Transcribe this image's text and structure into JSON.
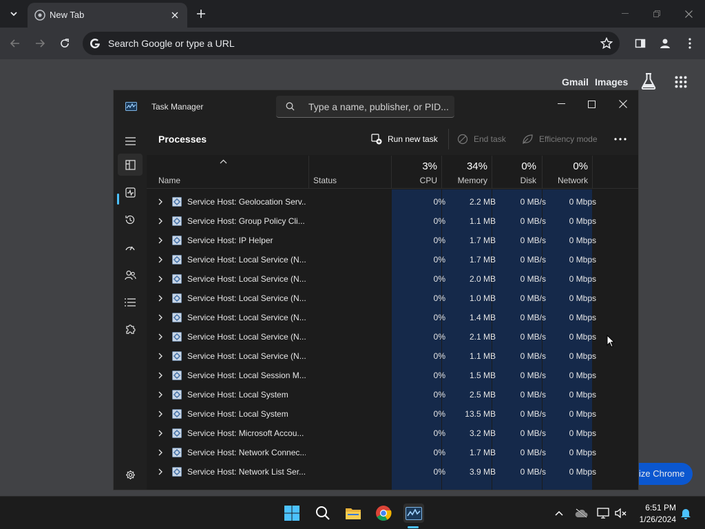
{
  "browser": {
    "tab_title": "New Tab",
    "omnibox_placeholder": "Search Google or type a URL",
    "links": {
      "gmail": "Gmail",
      "images": "Images"
    },
    "customize_label": "Customize Chrome",
    "customize_visible": "ize Chrome"
  },
  "task_manager": {
    "title": "Task Manager",
    "search_placeholder": "Type a name, publisher, or PID...",
    "page_heading": "Processes",
    "commands": {
      "run_new_task": "Run new task",
      "end_task": "End task",
      "efficiency_mode": "Efficiency mode"
    },
    "columns": {
      "name": "Name",
      "status": "Status",
      "cpu": {
        "label": "CPU",
        "percent": "3%"
      },
      "memory": {
        "label": "Memory",
        "percent": "34%"
      },
      "disk": {
        "label": "Disk",
        "percent": "0%"
      },
      "network": {
        "label": "Network",
        "percent": "0%"
      }
    },
    "rows": [
      {
        "name": "Service Host: Geolocation Serv...",
        "cpu": "0%",
        "memory": "2.2 MB",
        "disk": "0 MB/s",
        "network": "0 Mbps"
      },
      {
        "name": "Service Host: Group Policy Cli...",
        "cpu": "0%",
        "memory": "1.1 MB",
        "disk": "0 MB/s",
        "network": "0 Mbps"
      },
      {
        "name": "Service Host: IP Helper",
        "cpu": "0%",
        "memory": "1.7 MB",
        "disk": "0 MB/s",
        "network": "0 Mbps"
      },
      {
        "name": "Service Host: Local Service (N...",
        "cpu": "0%",
        "memory": "1.7 MB",
        "disk": "0 MB/s",
        "network": "0 Mbps"
      },
      {
        "name": "Service Host: Local Service (N...",
        "cpu": "0%",
        "memory": "2.0 MB",
        "disk": "0 MB/s",
        "network": "0 Mbps"
      },
      {
        "name": "Service Host: Local Service (N...",
        "cpu": "0%",
        "memory": "1.0 MB",
        "disk": "0 MB/s",
        "network": "0 Mbps"
      },
      {
        "name": "Service Host: Local Service (N...",
        "cpu": "0%",
        "memory": "1.4 MB",
        "disk": "0 MB/s",
        "network": "0 Mbps"
      },
      {
        "name": "Service Host: Local Service (N...",
        "cpu": "0%",
        "memory": "2.1 MB",
        "disk": "0 MB/s",
        "network": "0 Mbps"
      },
      {
        "name": "Service Host: Local Service (N...",
        "cpu": "0%",
        "memory": "1.1 MB",
        "disk": "0 MB/s",
        "network": "0 Mbps"
      },
      {
        "name": "Service Host: Local Session M...",
        "cpu": "0%",
        "memory": "1.5 MB",
        "disk": "0 MB/s",
        "network": "0 Mbps"
      },
      {
        "name": "Service Host: Local System",
        "cpu": "0%",
        "memory": "2.5 MB",
        "disk": "0 MB/s",
        "network": "0 Mbps"
      },
      {
        "name": "Service Host: Local System",
        "cpu": "0%",
        "memory": "13.5 MB",
        "disk": "0 MB/s",
        "network": "0 Mbps"
      },
      {
        "name": "Service Host: Microsoft Accou...",
        "cpu": "0%",
        "memory": "3.2 MB",
        "disk": "0 MB/s",
        "network": "0 Mbps"
      },
      {
        "name": "Service Host: Network Connec...",
        "cpu": "0%",
        "memory": "1.7 MB",
        "disk": "0 MB/s",
        "network": "0 Mbps"
      },
      {
        "name": "Service Host: Network List Ser...",
        "cpu": "0%",
        "memory": "3.9 MB",
        "disk": "0 MB/s",
        "network": "0 Mbps"
      }
    ]
  },
  "taskbar": {
    "time": "6:51 PM",
    "date": "1/26/2024"
  },
  "colors": {
    "accent": "#4cc2ff",
    "heat": "#15294a",
    "chrome_blue": "#0b57d0"
  }
}
